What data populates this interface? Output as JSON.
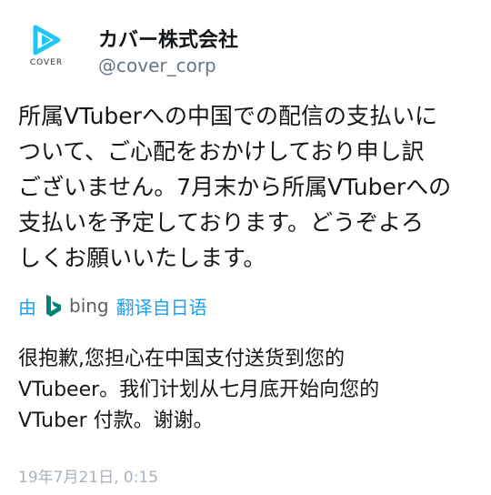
{
  "account": {
    "display_name": "カバー株式会社",
    "handle": "@cover_corp",
    "avatar_label": "COVER",
    "avatar_icon": "cover-logo-icon",
    "brand_color": "#1ec6f5"
  },
  "tweet": {
    "lines": [
      "所属VTuberへの中国での配信の支払いに",
      "ついて、ご心配をおかけしており申し訳",
      "ございません。7月末から所属VTuberへの",
      "支払いを予定しております。どうぞよろ",
      "しくお願いいたします。"
    ]
  },
  "translation": {
    "by_label": "由",
    "provider_icon": "bing-icon",
    "provider_label": "bing",
    "source_label": "翻译自日语",
    "lines": [
      "很抱歉,您担心在中国支付送货到您的",
      "VTubeer。我们计划从七月底开始向您的",
      "VTuber 付款。谢谢。"
    ]
  },
  "meta": {
    "timestamp": "19年7月21日, 0:15"
  },
  "colors": {
    "link": "#1da1f2",
    "muted": "#657786",
    "timestamp": "#a8b3bd",
    "bing": "#008373"
  }
}
